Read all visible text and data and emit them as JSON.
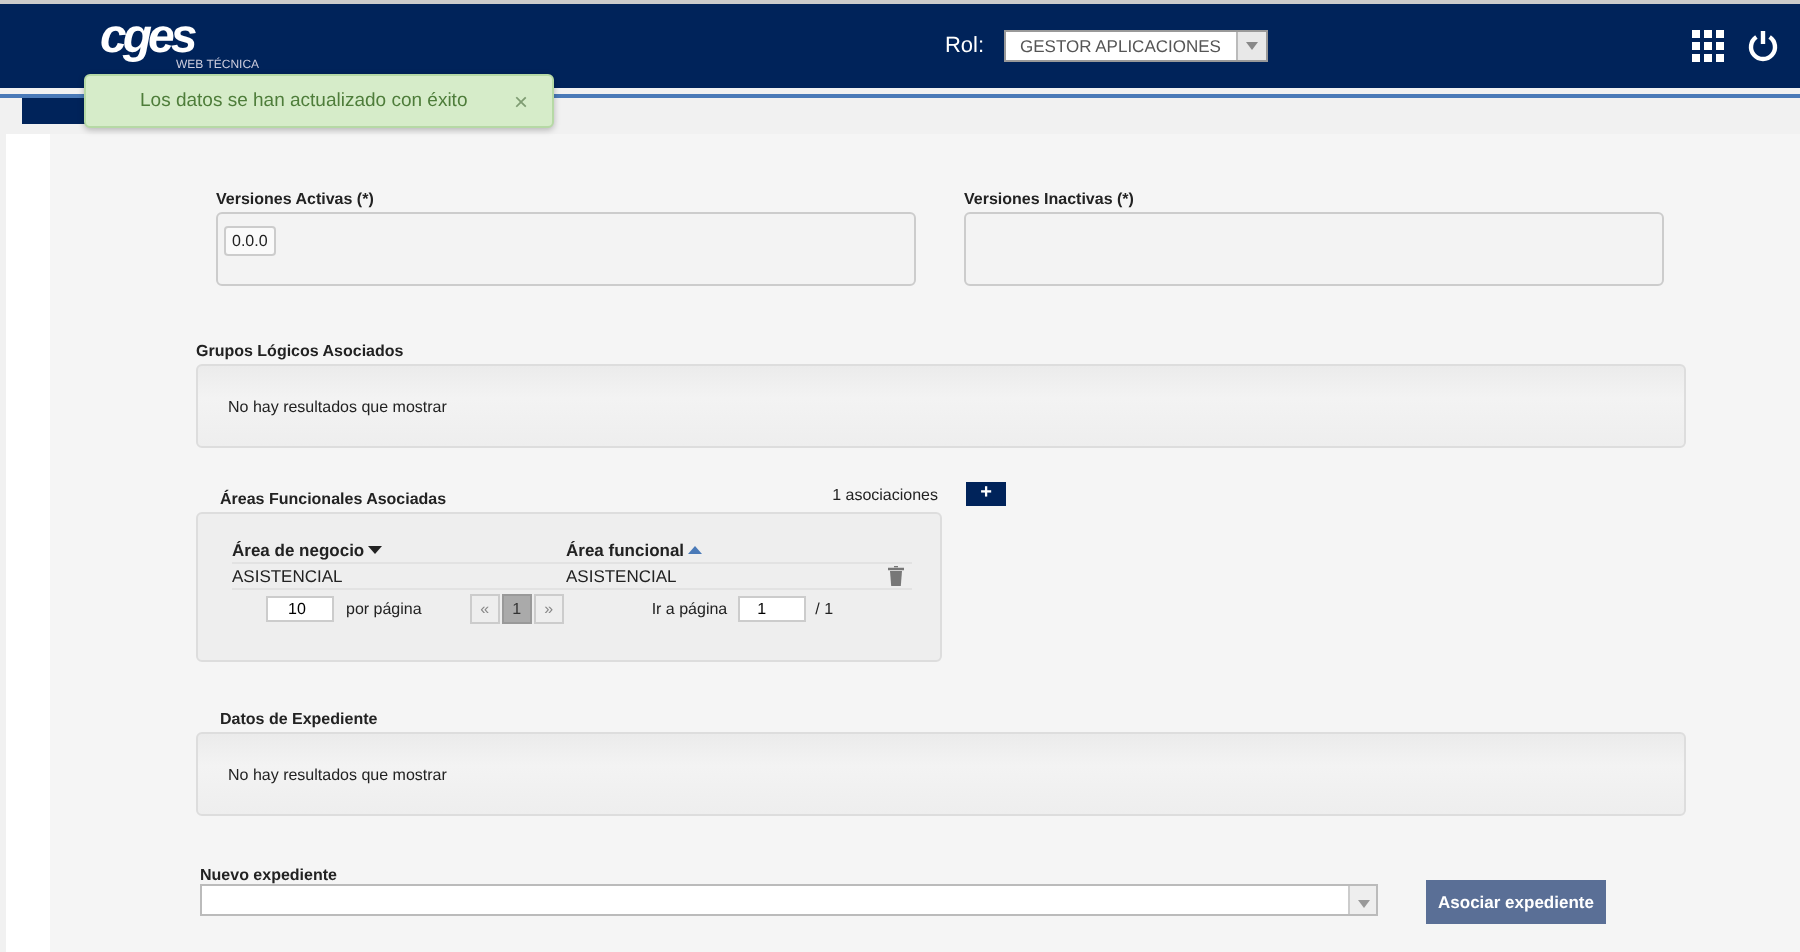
{
  "header": {
    "logo": "cges",
    "logo_sub": "WEB TÉCNICA",
    "role_label": "Rol:",
    "role_value": "GESTOR APLICACIONES"
  },
  "toast": {
    "message": "Los datos se han actualizado con éxito",
    "close": "×"
  },
  "versions": [
    {
      "label": "Versiones Activas (*)",
      "items": [
        "0.0.0"
      ]
    },
    {
      "label": "Versiones Inactivas (*)"
    }
  ],
  "grupos": {
    "label": "Grupos Lógicos Asociados",
    "empty": "No hay resultados que mostrar"
  },
  "areas": {
    "label": "Áreas Funcionales Asociadas",
    "count": "1 asociaciones",
    "add": "+",
    "columns": [
      {
        "label": "Área de negocio",
        "sort_ascending": false
      },
      {
        "label": "Área funcional",
        "sort_ascending": true
      }
    ],
    "rows": [
      [
        "ASISTENCIAL",
        "ASISTENCIAL"
      ]
    ],
    "per_page": "10",
    "per_page_label": "por página",
    "prev": "«",
    "next": "»",
    "pages": [
      {
        "label": "1",
        "selected": true
      }
    ],
    "goto_label": "Ir a página",
    "goto_value": "1",
    "total": "/ 1"
  },
  "datos": {
    "label": "Datos de Expediente",
    "empty": "No hay resultados que mostrar"
  },
  "nuevo": {
    "label": "Nuevo expediente",
    "button": "Asociar expediente"
  }
}
